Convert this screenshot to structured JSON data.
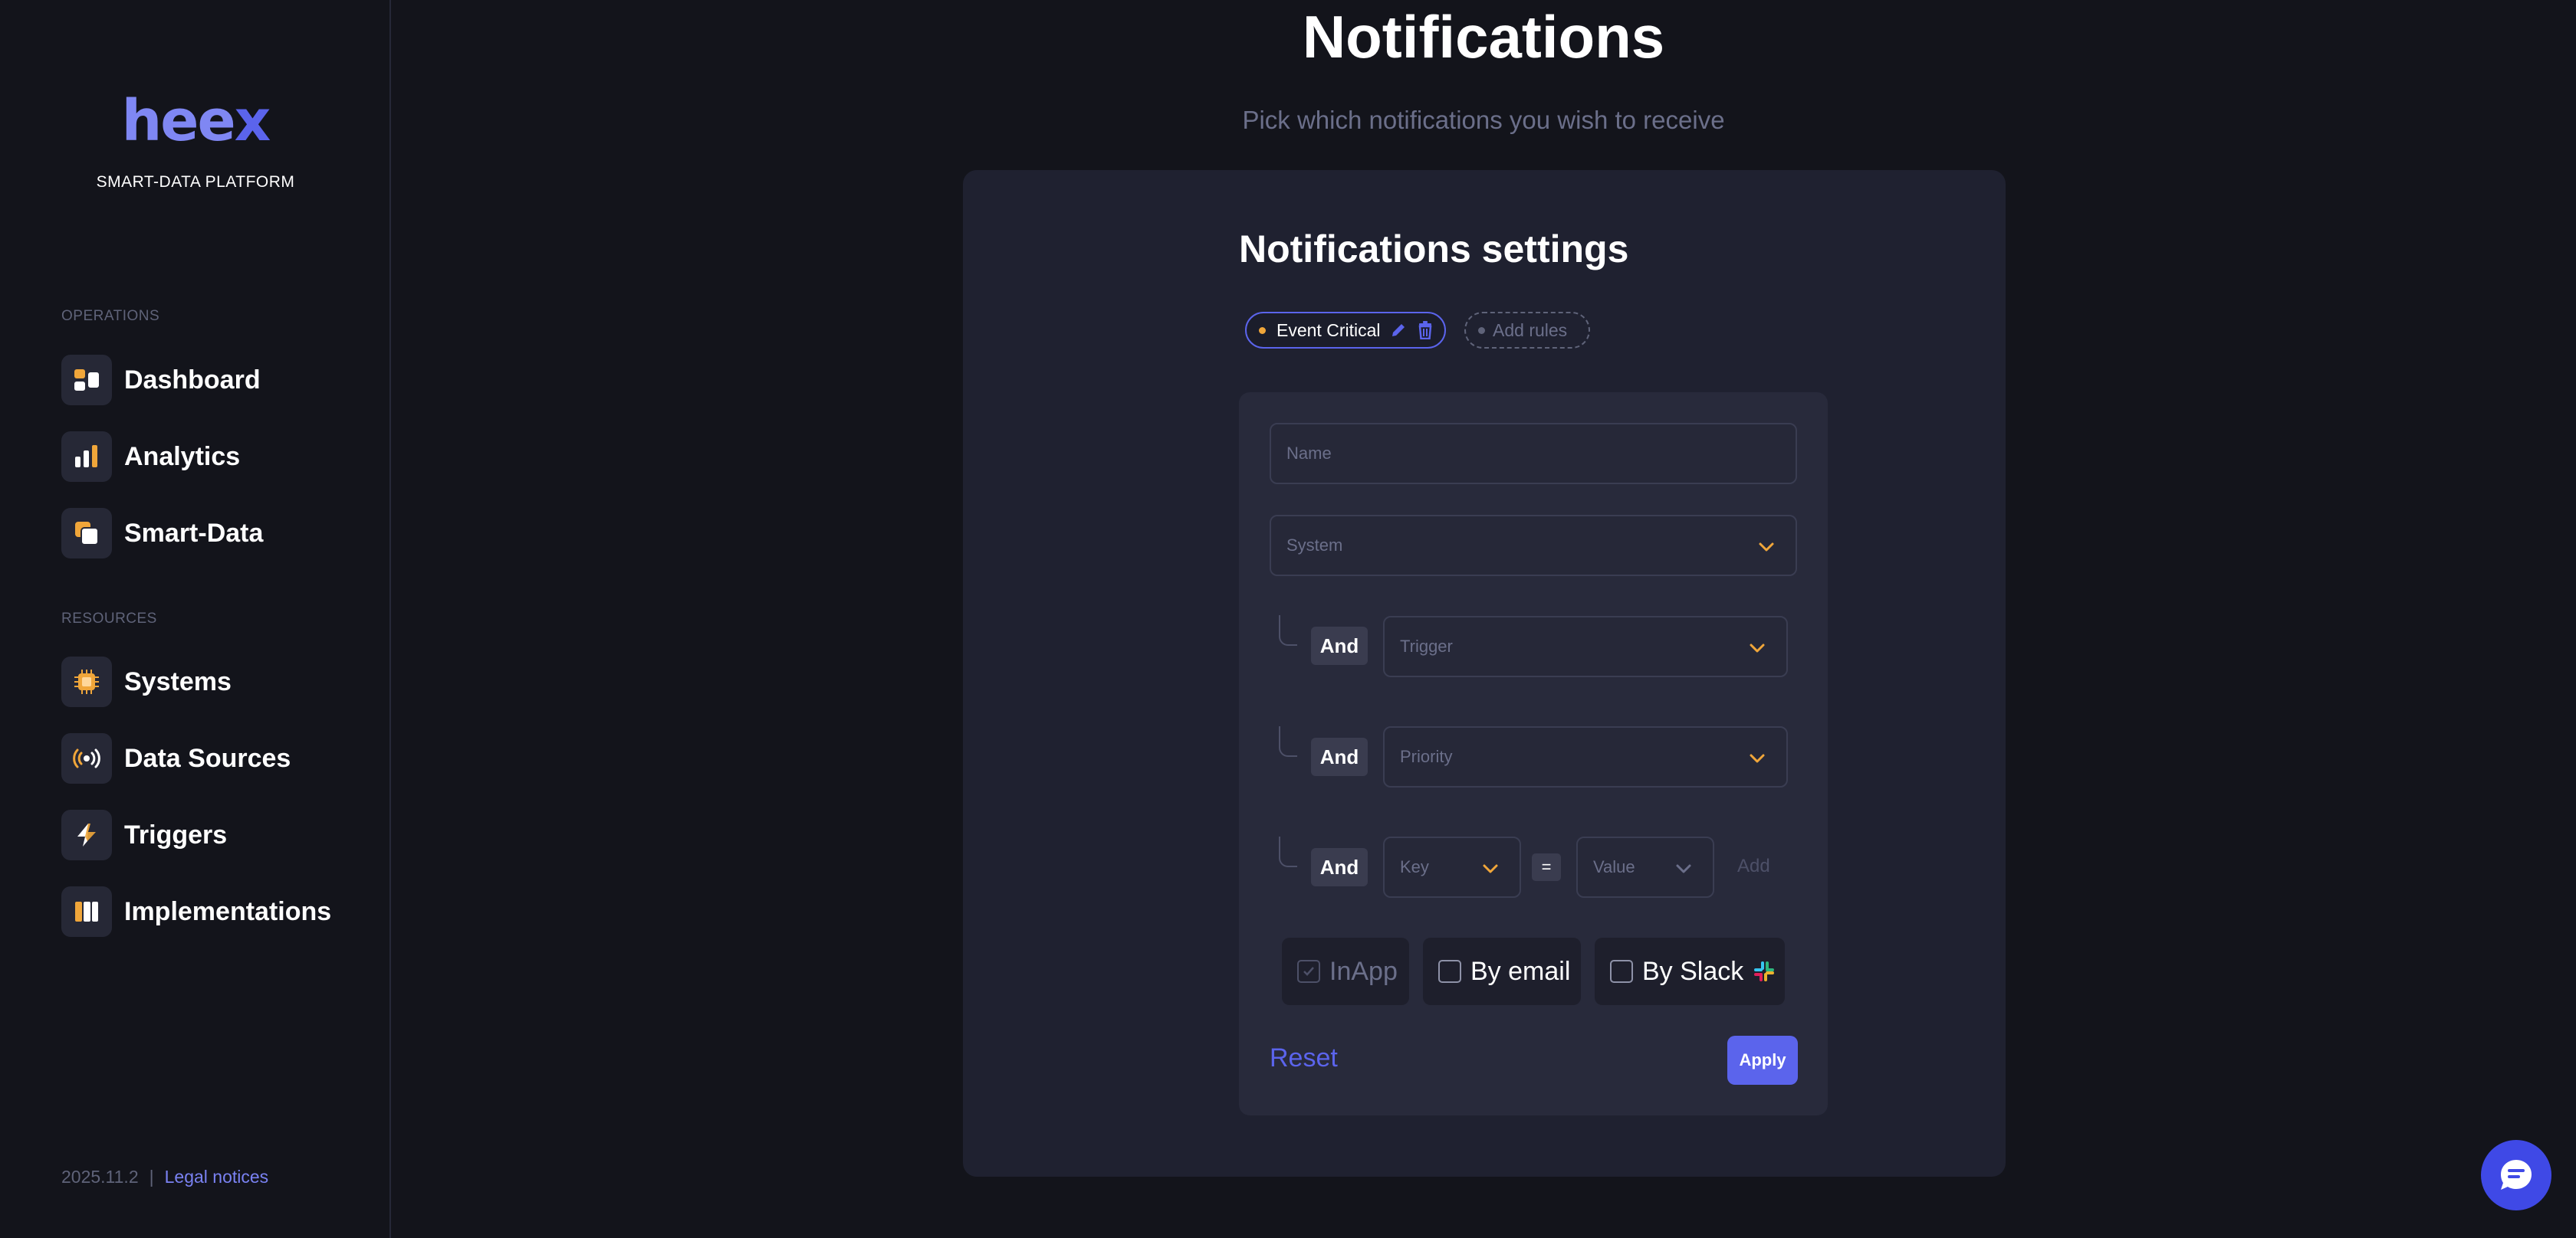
{
  "brand": {
    "logo_main": "hee",
    "logo_x": "x",
    "tagline": "SMART-DATA PLATFORM"
  },
  "sidebar": {
    "operations_label": "OPERATIONS",
    "operations": [
      {
        "label": "Dashboard",
        "icon": "dashboard-icon"
      },
      {
        "label": "Analytics",
        "icon": "analytics-icon"
      },
      {
        "label": "Smart-Data",
        "icon": "smart-data-icon"
      }
    ],
    "resources_label": "RESOURCES",
    "resources": [
      {
        "label": "Systems",
        "icon": "chip-icon"
      },
      {
        "label": "Data Sources",
        "icon": "broadcast-icon"
      },
      {
        "label": "Triggers",
        "icon": "lightning-icon"
      },
      {
        "label": "Implementations",
        "icon": "columns-icon"
      }
    ],
    "version": "2025.11.2",
    "separator": "|",
    "legal": "Legal notices"
  },
  "header": {
    "title": "Notifications",
    "subtitle": "Pick which notifications you wish to receive"
  },
  "settings": {
    "title": "Notifications settings",
    "rules": [
      {
        "label": "Event Critical",
        "active": true
      }
    ],
    "add_rules_label": "Add rules",
    "form": {
      "name_placeholder": "Name",
      "system_placeholder": "System",
      "and_label": "And",
      "trigger_placeholder": "Trigger",
      "priority_placeholder": "Priority",
      "key_placeholder": "Key",
      "equals": "=",
      "value_placeholder": "Value",
      "add_label": "Add"
    },
    "channels": {
      "inapp": {
        "label": "InApp",
        "checked": true,
        "disabled": true
      },
      "email": {
        "label": "By email",
        "checked": false
      },
      "slack": {
        "label": "By Slack",
        "checked": false
      }
    },
    "reset_label": "Reset",
    "apply_label": "Apply"
  },
  "colors": {
    "accent": "#5b64ec",
    "warning_orange": "#f0a63a",
    "background": "#13141b",
    "panel": "#1f2130"
  }
}
